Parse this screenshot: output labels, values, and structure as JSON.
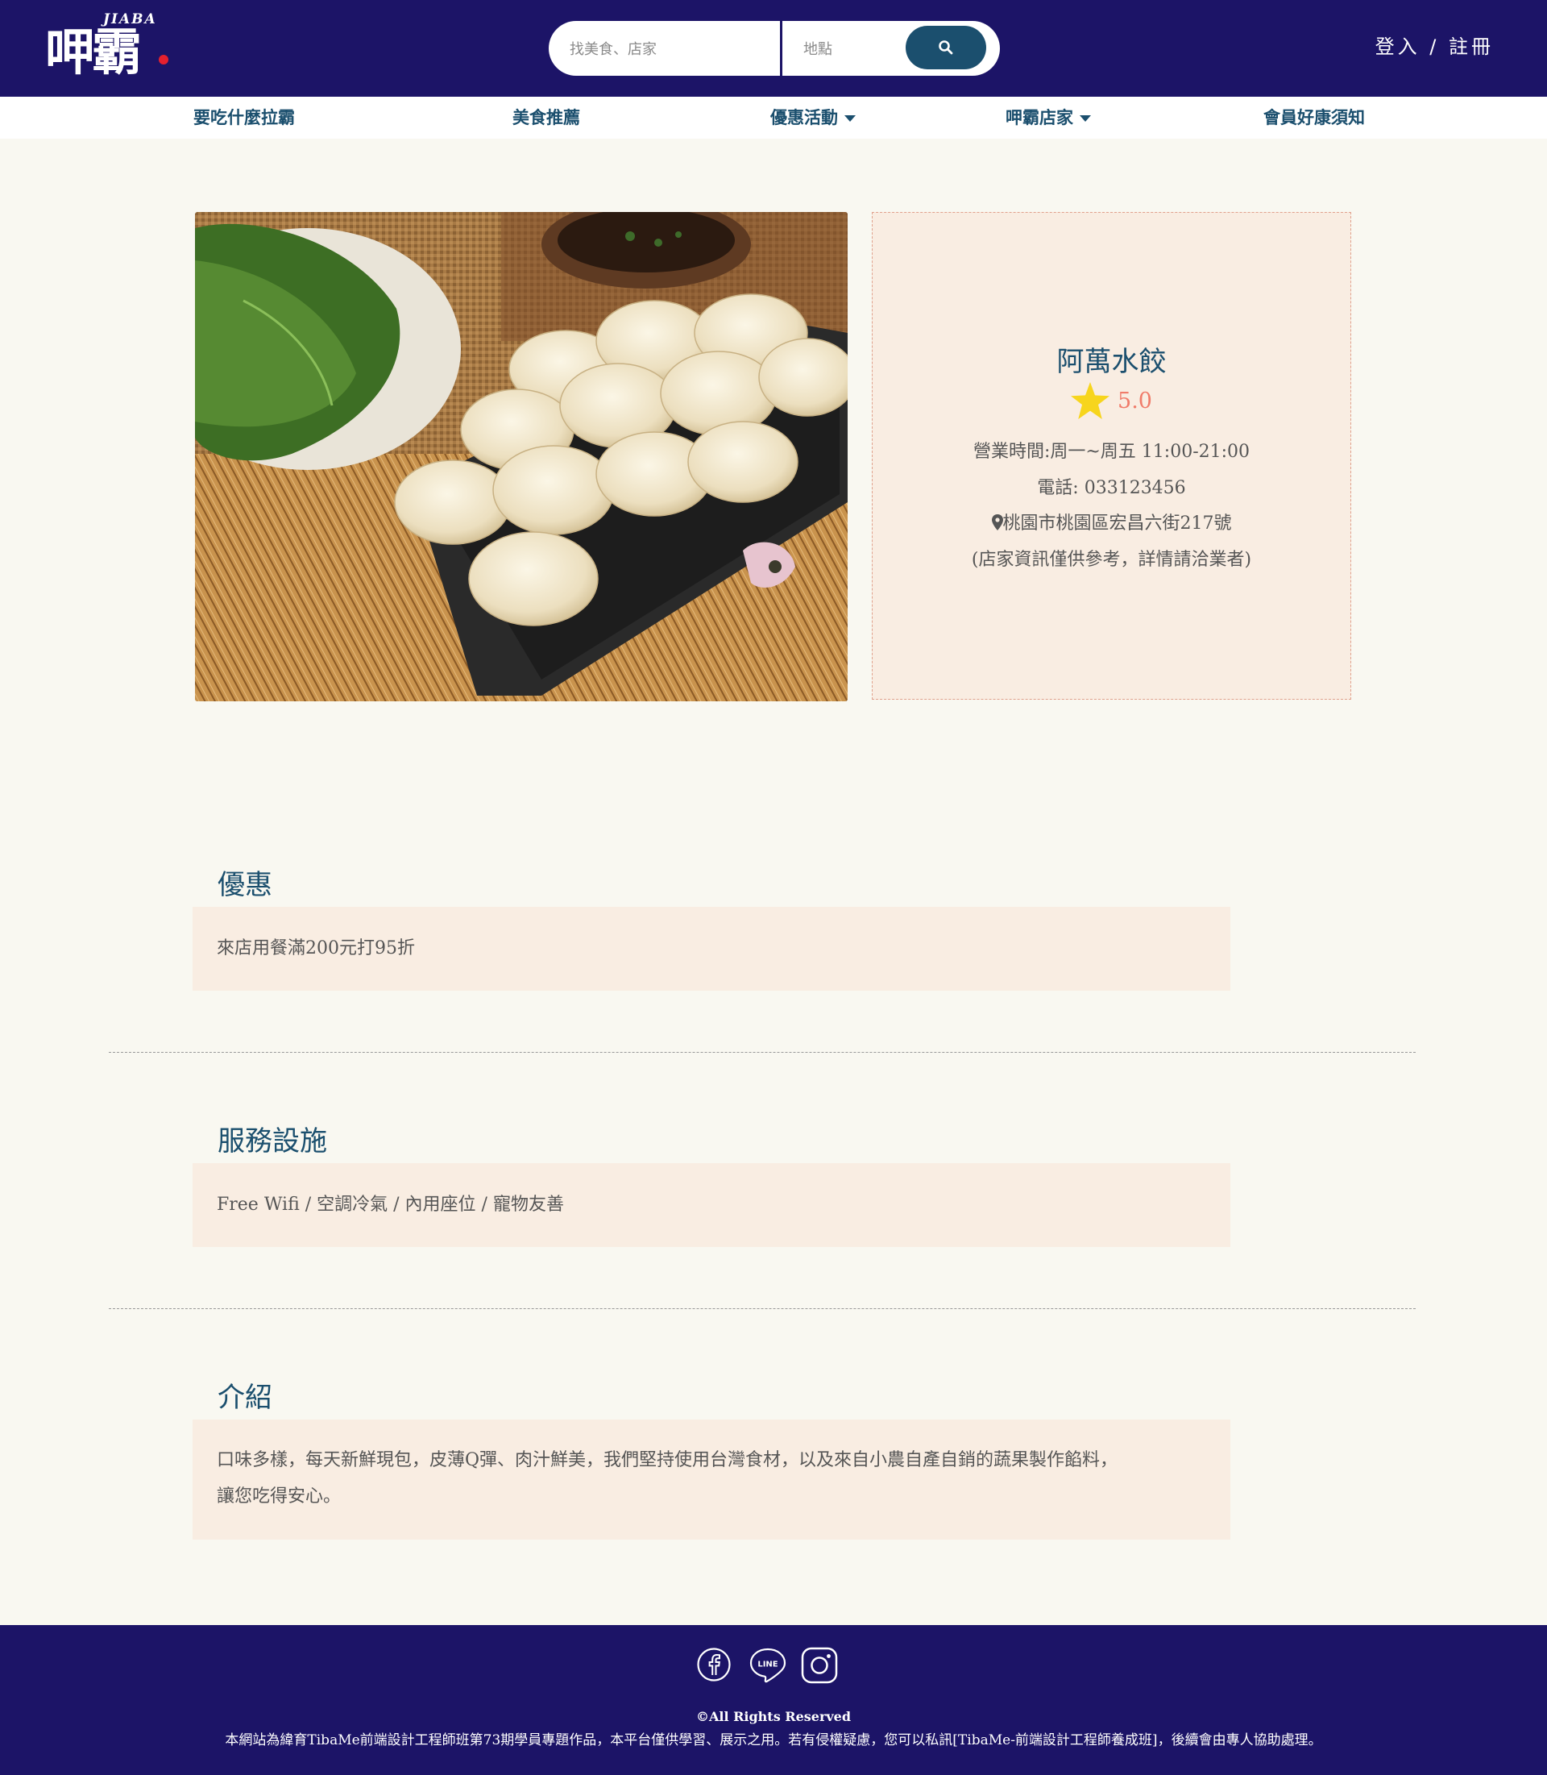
{
  "header": {
    "logo_text_latin": "JIABA",
    "logo_text": "呷霸",
    "search": {
      "food_placeholder": "找美食、店家",
      "location_placeholder": "地點",
      "button_icon": "search-icon"
    },
    "auth": {
      "login": "登入",
      "separator": "/",
      "register": "註冊"
    }
  },
  "nav": {
    "items": [
      {
        "label": "要吃什麼拉霸",
        "dropdown": false
      },
      {
        "label": "美食推薦",
        "dropdown": false
      },
      {
        "label": "優惠活動",
        "dropdown": true
      },
      {
        "label": "呷霸店家",
        "dropdown": true
      },
      {
        "label": "會員好康須知",
        "dropdown": false
      }
    ]
  },
  "shop": {
    "name": "阿萬水餃",
    "rating": "5.0",
    "hours": "營業時間:周一~周五 11:00-21:00",
    "phone": "電話: 033123456",
    "address": "桃園市桃園區宏昌六街217號",
    "note": "(店家資訊僅供參考，詳情請洽業者)",
    "photo_alt": "dumplings-photo"
  },
  "sections": {
    "offer": {
      "title": "優惠",
      "content": "來店用餐滿200元打95折"
    },
    "services": {
      "title": "服務設施",
      "content": "Free Wifi / 空調冷氣 / 內用座位 / 寵物友善"
    },
    "intro": {
      "title": "介紹",
      "line1": "口味多樣，每天新鮮現包，皮薄Q彈、肉汁鮮美，我們堅持使用台灣食材，以及來自小農自產自銷的蔬果製作餡料，",
      "line2": "讓您吃得安心。"
    }
  },
  "footer": {
    "social": [
      "facebook-icon",
      "line-icon",
      "instagram-icon"
    ],
    "line_label": "LINE",
    "rights": "©All Rights Reserved",
    "disclaimer": "本網站為緯育TibaMe前端設計工程師班第73期學員專題作品，本平台僅供學習、展示之用。若有侵權疑慮，您可以私訊[TibaMe-前端設計工程師養成班]，後續會由專人協助處理。"
  },
  "colors": {
    "header_bg": "#1c1467",
    "accent": "#1b4f6e",
    "rating": "#f07c6a",
    "star": "#f7d51d",
    "card_bg": "#f9ede2",
    "page_bg": "#f9f8f1"
  }
}
